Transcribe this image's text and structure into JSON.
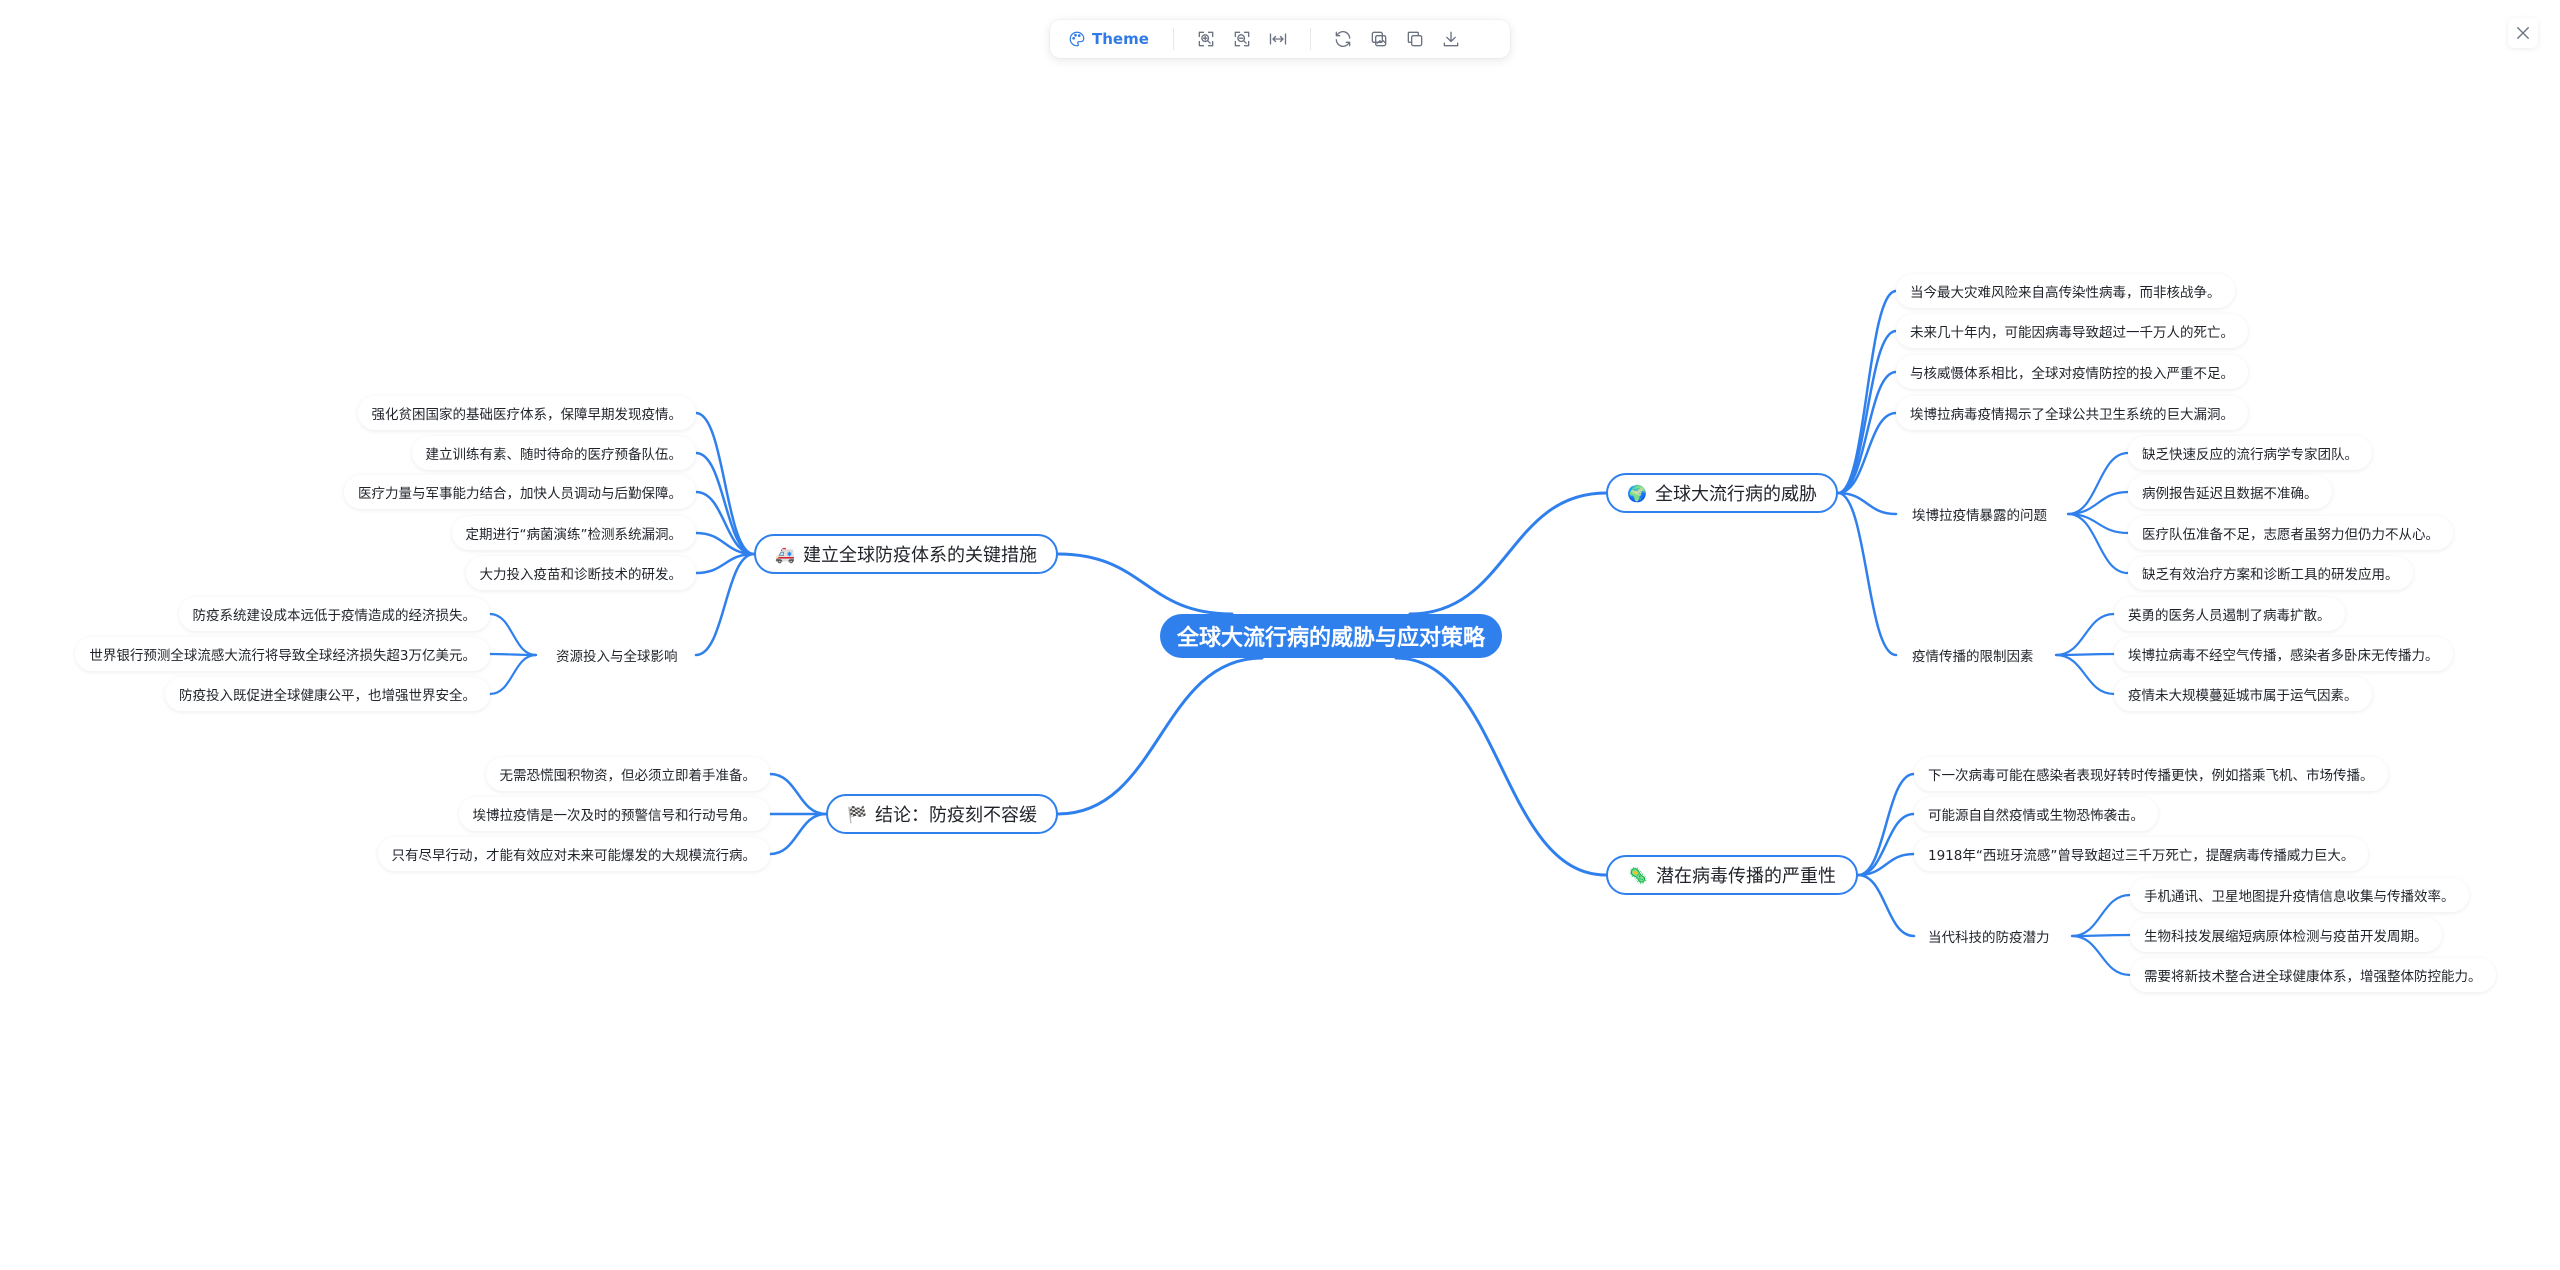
{
  "toolbar": {
    "theme_label": "Theme",
    "buttons": [
      "zoom-in-icon",
      "zoom-out-icon",
      "fit-width-icon",
      "refresh-icon",
      "copy-image-icon",
      "duplicate-icon",
      "download-icon"
    ]
  },
  "colors": {
    "accent": "#2f80ed",
    "line": "#2f80ed",
    "text": "#1f2329"
  },
  "mindmap": {
    "root": "全球大流行病的威胁与应对策略",
    "threat": {
      "emoji": "🌍",
      "label": "全球大流行病的威胁",
      "items": [
        "当今最大灾难风险来自高传染性病毒，而非核战争。",
        "未来几十年内，可能因病毒导致超过一千万人的死亡。",
        "与核威慑体系相比，全球对疫情防控的投入严重不足。",
        "埃博拉病毒疫情揭示了全球公共卫生系统的巨大漏洞。"
      ],
      "ebola_problems": {
        "label": "埃博拉疫情暴露的问题",
        "items": [
          "缺乏快速反应的流行病学专家团队。",
          "病例报告延迟且数据不准确。",
          "医疗队伍准备不足，志愿者虽努力但仍力不从心。",
          "缺乏有效治疗方案和诊断工具的研发应用。"
        ]
      },
      "limiting_factors": {
        "label": "疫情传播的限制因素",
        "items": [
          "英勇的医务人员遏制了病毒扩散。",
          "埃博拉病毒不经空气传播，感染者多卧床无传播力。",
          "疫情未大规模蔓延城市属于运气因素。"
        ]
      }
    },
    "severity": {
      "emoji": "🦠",
      "label": "潜在病毒传播的严重性",
      "items": [
        "下一次病毒可能在感染者表现好转时传播更快，例如搭乘飞机、市场传播。",
        "可能源自自然疫情或生物恐怖袭击。",
        "1918年“西班牙流感”曾导致超过三千万死亡，提醒病毒传播威力巨大。"
      ],
      "tech": {
        "label": "当代科技的防疫潜力",
        "items": [
          "手机通讯、卫星地图提升疫情信息收集与传播效率。",
          "生物科技发展缩短病原体检测与疫苗开发周期。",
          "需要将新技术整合进全球健康体系，增强整体防控能力。"
        ]
      }
    },
    "measures": {
      "emoji": "🚑",
      "label": "建立全球防疫体系的关键措施",
      "items": [
        "强化贫困国家的基础医疗体系，保障早期发现疫情。",
        "建立训练有素、随时待命的医疗预备队伍。",
        "医疗力量与军事能力结合，加快人员调动与后勤保障。",
        "定期进行“病菌演练”检测系统漏洞。",
        "大力投入疫苗和诊断技术的研发。"
      ],
      "resources": {
        "label": "资源投入与全球影响",
        "items": [
          "防疫系统建设成本远低于疫情造成的经济损失。",
          "世界银行预测全球流感大流行将导致全球经济损失超3万亿美元。",
          "防疫投入既促进全球健康公平，也增强世界安全。"
        ]
      }
    },
    "conclusion": {
      "emoji": "🏁",
      "label": "结论：防疫刻不容缓",
      "items": [
        "无需恐慌囤积物资，但必须立即着手准备。",
        "埃博拉疫情是一次及时的预警信号和行动号角。",
        "只有尽早行动，才能有效应对未来可能爆发的大规模流行病。"
      ]
    }
  }
}
